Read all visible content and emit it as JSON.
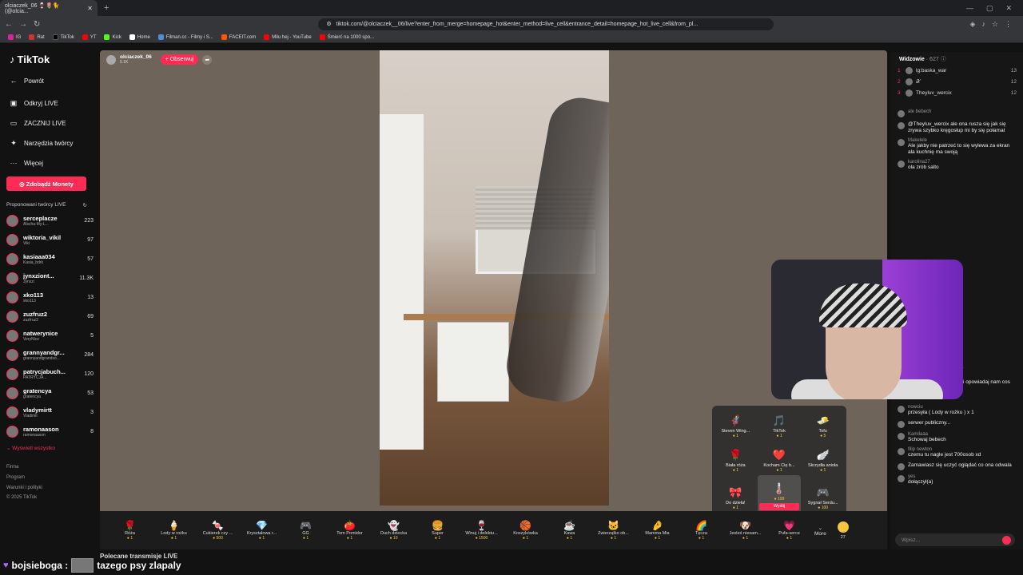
{
  "browser": {
    "tab_title": "olciaczek_06 🍷🌷🐈 (@olcia...",
    "url": "tiktok.com/@olciaczek__06/live?enter_from_merge=homepage_hot&enter_method=live_cell&entrance_detail=homepage_hot_live_cell&from_pl...",
    "bookmarks": [
      "IG",
      "Rat",
      "TikTok",
      "YT",
      "Kick",
      "Home",
      "Filman.cc - Filmy i S...",
      "FACEIT.com",
      "Milu hej - YouTube",
      "Śmierć na 1000 spo..."
    ]
  },
  "sidebar": {
    "logo": "TikTok",
    "back": "Powrót",
    "nav": [
      "Odkryj LIVE",
      "ZACZNIJ LIVE",
      "Narzędzia twórcy",
      "Więcej"
    ],
    "coins_button": "Zdobądź Monety",
    "recommended_title": "Proponowani twórcy LIVE",
    "creators": [
      {
        "name": "serceplacze",
        "sub": "Alscha-My-L...",
        "count": "223"
      },
      {
        "name": "wiktoria_vikil",
        "sub": "Viki",
        "count": "97"
      },
      {
        "name": "kasiaaa034",
        "sub": "Kasia_bdrk",
        "count": "57"
      },
      {
        "name": "jynxziont...",
        "sub": "Jynxzi",
        "count": "11.3K"
      },
      {
        "name": "xko113",
        "sub": "xko113",
        "count": "13"
      },
      {
        "name": "zuzfruz2",
        "sub": "zuzfruz2",
        "count": "69"
      },
      {
        "name": "natwerynice",
        "sub": "VeryNice",
        "count": "5"
      },
      {
        "name": "grannyandgr...",
        "sub": "grannyandgrandso...",
        "count": "284"
      },
      {
        "name": "patrycjabuch...",
        "sub": "PATRYCJA...",
        "count": "120"
      },
      {
        "name": "gratencya",
        "sub": "gratencya",
        "count": "53"
      },
      {
        "name": "vladymirtt",
        "sub": "Vladimir",
        "count": "3"
      },
      {
        "name": "ramonaason",
        "sub": "ramonaason",
        "count": "8"
      }
    ],
    "see_all": "Wyświetl wszystko",
    "footer": [
      "Firma",
      "Program",
      "Warunki i polityki",
      "© 2025 TikTok"
    ]
  },
  "stream": {
    "host_name": "olciaczek_06",
    "host_sub": "5.1K",
    "follow": "+ Obserwuj",
    "recommended_live": "Polecane transmisje LIVE"
  },
  "gift_panel": {
    "items": [
      {
        "name": "Steven Wing...",
        "price": "1",
        "icon": "🦸"
      },
      {
        "name": "TikTok",
        "price": "1",
        "icon": "🎵"
      },
      {
        "name": "Tofu",
        "price": "5",
        "icon": "🧈"
      },
      {
        "name": "Biała róża",
        "price": "1",
        "icon": "🌹"
      },
      {
        "name": "Kocham Cię b...",
        "price": "1",
        "icon": "❤️"
      },
      {
        "name": "Skrzydła anioła",
        "price": "1",
        "icon": "🪽"
      },
      {
        "name": "Do dzieła!",
        "price": "1",
        "icon": "🎀"
      },
      {
        "name": "199",
        "price": "",
        "icon": "🌡️",
        "selected": true
      },
      {
        "name": "Sygnał Serdu...",
        "price": "100",
        "icon": "🎮"
      },
      {
        "name": "Poranny rozk...",
        "price": "1",
        "icon": "🌸"
      },
      {
        "name": "Kciuk w górę",
        "price": "2",
        "icon": "👍"
      },
      {
        "name": "Serce z palców",
        "price": "5",
        "icon": "🫰"
      }
    ],
    "send_label": "Wyślij"
  },
  "gift_bar": {
    "items": [
      {
        "name": "Róża",
        "price": "1",
        "icon": "🌹"
      },
      {
        "name": "Lody w rożku",
        "price": "1",
        "icon": "🍦"
      },
      {
        "name": "Cukierek czy ...",
        "price": "500",
        "icon": "🍬"
      },
      {
        "name": "Kryształowa r...",
        "price": "1",
        "icon": "💎"
      },
      {
        "name": "GG",
        "price": "1",
        "icon": "🎮"
      },
      {
        "name": "Tom Pomidor",
        "price": "1",
        "icon": "🍅"
      },
      {
        "name": "Duch dziecka",
        "price": "10",
        "icon": "👻"
      },
      {
        "name": "Super",
        "price": "1",
        "icon": "🍔"
      },
      {
        "name": "Winuj i delektu...",
        "price": "1500",
        "icon": "🍷"
      },
      {
        "name": "Koszykówka",
        "price": "1",
        "icon": "🏀"
      },
      {
        "name": "Kawa",
        "price": "1",
        "icon": "☕"
      },
      {
        "name": "Zwierzątko ob...",
        "price": "1",
        "icon": "🐱"
      },
      {
        "name": "Mamma Mia",
        "price": "1",
        "icon": "🤌"
      },
      {
        "name": "Tęcza",
        "price": "1",
        "icon": "🌈"
      },
      {
        "name": "Jesteś niesam...",
        "price": "1",
        "icon": "🐶"
      },
      {
        "name": "Pufa-serce",
        "price": "1",
        "icon": "💗"
      }
    ],
    "more": "More",
    "coins": "27"
  },
  "chat": {
    "viewers_label": "Widzowie",
    "viewers_count": "· 627",
    "top": [
      {
        "rank": "1",
        "name": "lg:baska_war",
        "num": "13"
      },
      {
        "rank": "2",
        "name": "𝒳",
        "num": "12"
      },
      {
        "rank": "3",
        "name": "Theyluv_wercix",
        "num": "12"
      }
    ],
    "messages": [
      {
        "user": "ale bebech",
        "text": ""
      },
      {
        "user": "",
        "text": "@Theyluv_wercix ale ona rusza się jak się zrywa szybko kręgosłup mi by się połamał"
      },
      {
        "user": "Makelele",
        "text": "Ale jakby nie patrzeć to się wylewa za ekran ala kuchnię ma swoją"
      },
      {
        "user": "karolina27",
        "text": "ola zrób salto"
      }
    ],
    "messages2": [
      {
        "user": "Agulka",
        "text": "masakra do spaniaaaaa"
      },
      {
        "user": "tosti",
        "text": "olcia wyłączaj ten sciek i opowiadaj nam cos"
      },
      {
        "user": "nikolA",
        "text": "@ REL"
      },
      {
        "user": "nowciu",
        "text": "przesyła ( Lody w rożku ) x 1"
      },
      {
        "user": "",
        "text": "serwer publiczny..."
      },
      {
        "user": "Kamilaaa",
        "text": "Schowaj bebech"
      },
      {
        "user": "filip newton",
        "text": "czemu tu nagle jest 700osob xd"
      },
      {
        "user": "",
        "text": "Zamawiasz się uczyć oglądać co ona odwala"
      },
      {
        "user": "yes",
        "text": "dołączył(a)"
      }
    ],
    "input_placeholder": "Wpisz..."
  },
  "overlay": {
    "user": "bojsieboga :",
    "text": "tazego psy zlapaly"
  }
}
